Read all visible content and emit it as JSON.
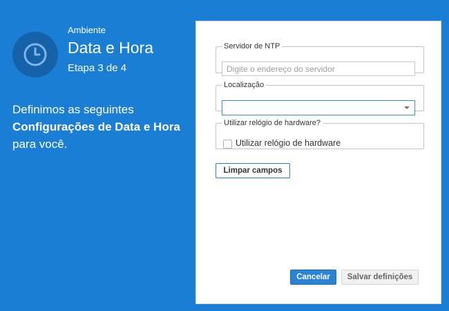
{
  "sidebar": {
    "section": "Ambiente",
    "title": "Data e Hora",
    "step": "Etapa 3 de 4",
    "intro_prefix": "Definimos as seguintes ",
    "intro_bold": "Configurações de Data e Hora",
    "intro_suffix": " para você.",
    "icon": "clock-icon"
  },
  "form": {
    "ntp": {
      "legend": "Servidor de NTP",
      "value": "",
      "placeholder": "Digite o endereço do servidor"
    },
    "location": {
      "legend": "Localização",
      "value": ""
    },
    "hardware_clock": {
      "legend": "Utilizar relógio de hardware?",
      "checkbox_label": "Utilizar relógio de hardware",
      "checked": false
    },
    "clear_button": "Limpar campos"
  },
  "actions": {
    "cancel": "Cancelar",
    "save": "Salvar definições"
  },
  "colors": {
    "background": "#1a7fd4",
    "accent": "#2b83d3"
  }
}
